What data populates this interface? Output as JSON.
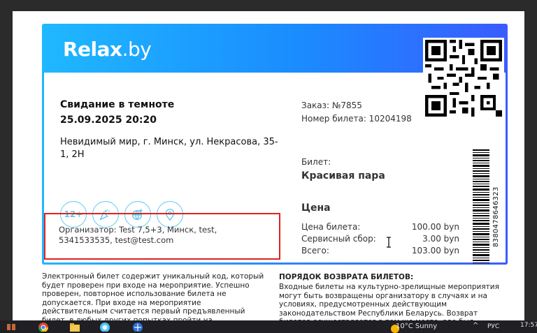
{
  "ticket": {
    "logo": "Relax.by",
    "event_title": "Свидание в темноте",
    "event_datetime": "25.09.2025 20:20",
    "venue": "Невидимый мир, г. Минск, ул. Некрасова, 35-1, 2Н",
    "order_number": "Заказ: №7855",
    "ticket_number": "Номер билета: 10204198",
    "ticket_label": "Билет:",
    "ticket_type": "Красивая пара",
    "price_heading": "Цена",
    "prices": [
      {
        "label": "Цена билета:",
        "amount": "100.00 byn"
      },
      {
        "label": "Сервисный сбор:",
        "amount": "3.00 byn"
      },
      {
        "label": "Всего:",
        "amount": "103.00 byn"
      }
    ],
    "barcode_number": "8380478646323",
    "age_badge": "12+",
    "organizer": "Организатор: Test 7,5+3, Минск, test, 5341533535, test@test.com",
    "icons": [
      "age-rating-icon",
      "party-popper-icon",
      "globe-icon",
      "location-pin-icon"
    ]
  },
  "description": {
    "left_text": "Электронный билет содержит уникальный код, который будет проверен при входе на мероприятие. Успешно проверен, повторное использование билета не допускается. При входе на мероприятие действительным считается первый предъявленный билет, в любых других попытках пройти на мероприятие по уже просканированному",
    "refund_heading": "ПОРЯДОК ВОЗВРАТА БИЛЕТОВ:",
    "refund_text": "Входные билеты на культурно-зрелищные мероприятия могут быть возвращены организатору в случаях и на условиях, предусмотренных действующим законодательством Республики Беларусь. Возврат билетов осуществляется в том же месте, где был приобретен билет"
  },
  "taskbar": {
    "weather": "10°C  Sunny",
    "language": "РУС",
    "time": "17:57"
  },
  "colors": {
    "header_gradient_start": "#1fb8ff",
    "header_gradient_end": "#3a5cff",
    "icon_accent": "#5ccbf4",
    "highlight_box": "#e0211f"
  }
}
